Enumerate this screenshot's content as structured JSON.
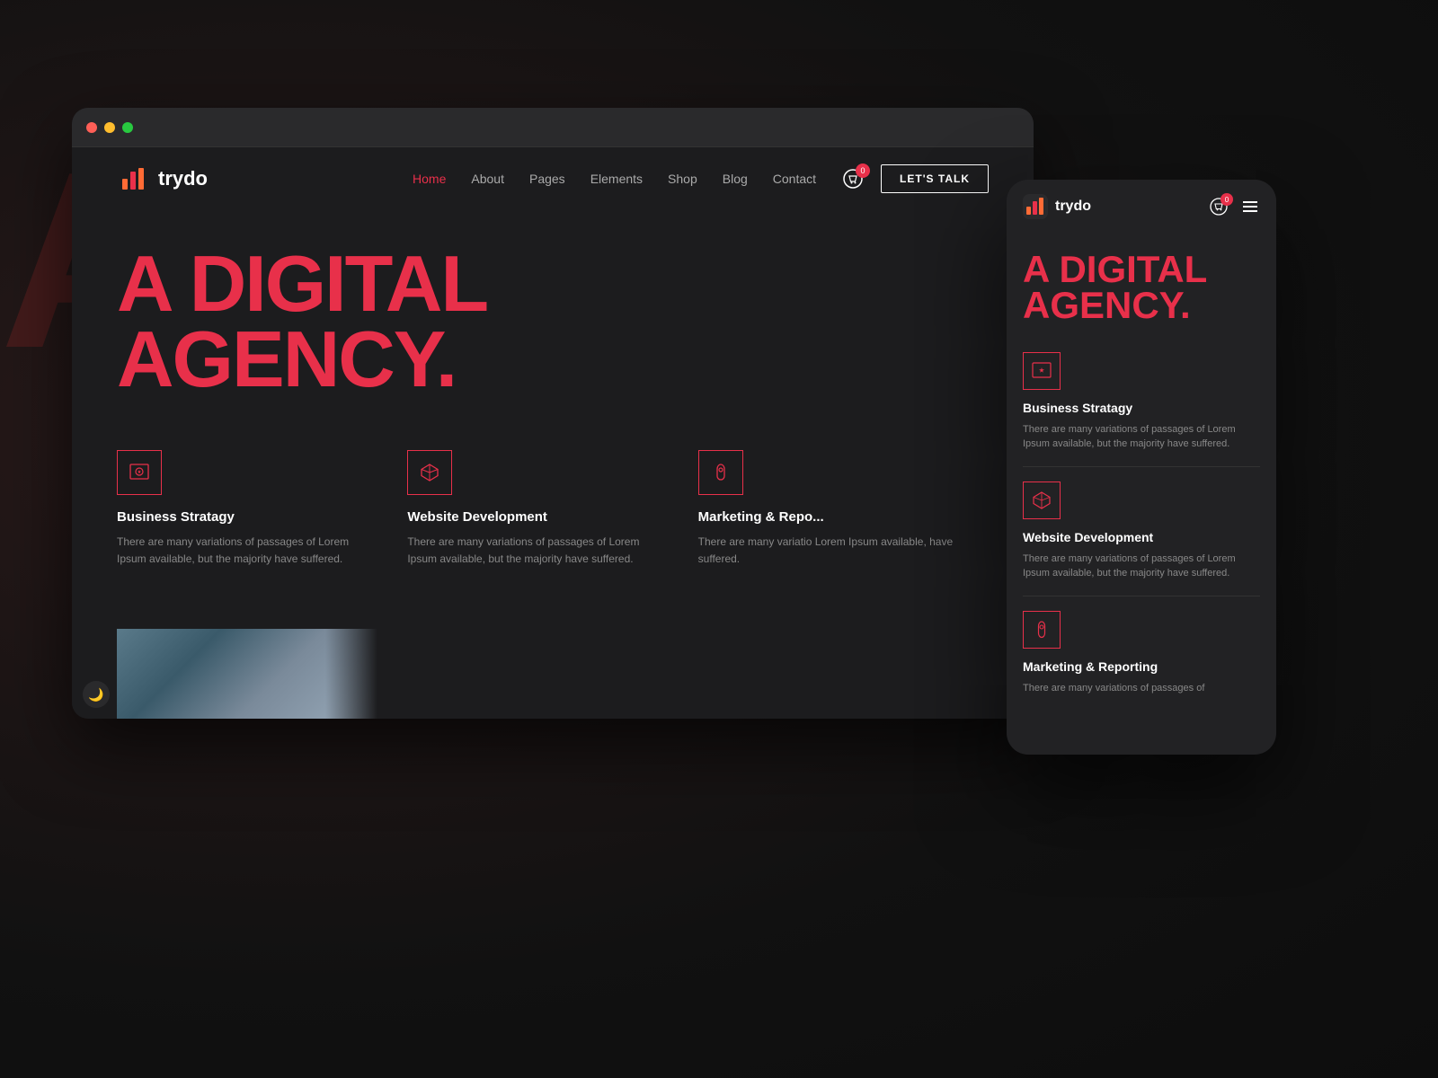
{
  "brand": {
    "logo_text": "trydo",
    "logo_icon_label": "trydo-logo-icon"
  },
  "desktop": {
    "nav": {
      "links": [
        {
          "label": "Home",
          "active": true
        },
        {
          "label": "About",
          "active": false
        },
        {
          "label": "Pages",
          "active": false
        },
        {
          "label": "Elements",
          "active": false
        },
        {
          "label": "Shop",
          "active": false
        },
        {
          "label": "Blog",
          "active": false
        },
        {
          "label": "Contact",
          "active": false
        }
      ],
      "cart_count": "0",
      "cta_label": "LET'S TALK"
    },
    "hero": {
      "title_line1": "A DIGITAL",
      "title_line2": "AGENCY."
    },
    "services": [
      {
        "icon": "star",
        "title": "Business Stratagy",
        "desc": "There are many variations of passages of Lorem Ipsum available, but the majority have suffered."
      },
      {
        "icon": "box",
        "title": "Website Development",
        "desc": "There are many variations of passages of Lorem Ipsum available, but the majority have suffered."
      },
      {
        "icon": "mouse",
        "title": "Marketing & Repo...",
        "desc": "There are many variatio Lorem Ipsum available, have suffered."
      }
    ]
  },
  "mobile": {
    "nav": {
      "cart_count": "0",
      "menu_icon_label": "hamburger-menu"
    },
    "hero": {
      "title_line1": "A DIGITAL",
      "title_line2": "AGENCY."
    },
    "services": [
      {
        "icon": "star",
        "title": "Business Stratagy",
        "desc": "There are many variations of passages of Lorem Ipsum available, but the majority have suffered."
      },
      {
        "icon": "box",
        "title": "Website Development",
        "desc": "There are many variations of passages of Lorem Ipsum available, but the majority have suffered."
      },
      {
        "icon": "mouse",
        "title": "Marketing & Reporting",
        "desc": "There are many variations of passages of"
      }
    ]
  },
  "bg_text": "AA",
  "dark_toggle": "🌙"
}
